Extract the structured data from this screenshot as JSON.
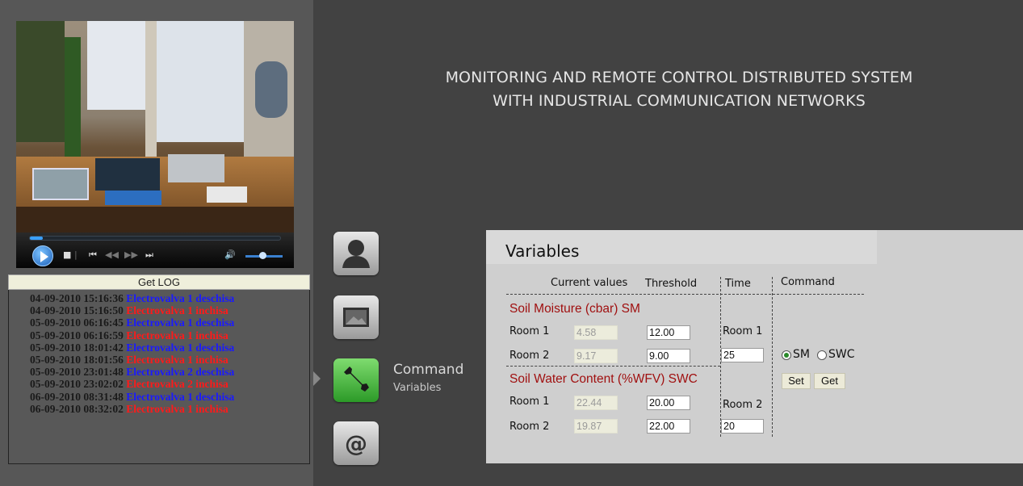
{
  "header": {
    "title_line1": "MONITORING AND REMOTE CONTROL DISTRIBUTED SYSTEM",
    "title_line2": "WITH INDUSTRIAL COMMUNICATION NETWORKS"
  },
  "video": {
    "progress": 0.05,
    "volume": 0.45
  },
  "log": {
    "button_label": "Get LOG",
    "entries": [
      {
        "time": "04-09-2010 15:16:36",
        "message": "Electrovalva 1 deschisa",
        "state": "open"
      },
      {
        "time": "04-09-2010 15:16:50",
        "message": "Electrovalva 1 inchisa",
        "state": "close"
      },
      {
        "time": "05-09-2010 06:16:45",
        "message": "Electrovalva 1 deschisa",
        "state": "open"
      },
      {
        "time": "05-09-2010 06:16:59",
        "message": "Electrovalva 1 inchisa",
        "state": "close"
      },
      {
        "time": "05-09-2010 18:01:42",
        "message": "Electrovalva 1 deschisa",
        "state": "open"
      },
      {
        "time": "05-09-2010 18:01:56",
        "message": "Electrovalva 1 inchisa",
        "state": "close"
      },
      {
        "time": "05-09-2010 23:01:48",
        "message": "Electrovalva 2 deschisa",
        "state": "open"
      },
      {
        "time": "05-09-2010 23:02:02",
        "message": "Electrovalva 2 inchisa",
        "state": "close"
      },
      {
        "time": "06-09-2010 08:31:48",
        "message": "Electrovalva 1 deschisa",
        "state": "open"
      },
      {
        "time": "06-09-2010 08:32:02",
        "message": "Electrovalva 1 inchisa",
        "state": "close"
      }
    ]
  },
  "nav": {
    "items": [
      {
        "icon": "user-icon",
        "active": false
      },
      {
        "icon": "image-icon",
        "active": false
      },
      {
        "icon": "wrench-icon",
        "active": true
      },
      {
        "icon": "at-sign-icon",
        "active": false
      }
    ],
    "active_label": "Command",
    "active_sublabel": "Variables"
  },
  "variables": {
    "title": "Variables",
    "col_current": "Current values",
    "col_threshold": "Threshold",
    "col_time": "Time",
    "col_command": "Command",
    "sm": {
      "title": "Soil Moisture (cbar) SM",
      "room1_label": "Room 1",
      "room1_current": "4.58",
      "room1_threshold": "12.00",
      "room2_label": "Room 2",
      "room2_current": "9.17",
      "room2_threshold": "9.00"
    },
    "swc": {
      "title": "Soil Water Content (%WFV) SWC",
      "room1_label": "Room 1",
      "room1_current": "22.44",
      "room1_threshold": "20.00",
      "room2_label": "Room 2",
      "room2_current": "19.87",
      "room2_threshold": "22.00"
    },
    "time": {
      "room1_label": "Room 1",
      "room1_value": "25",
      "room2_label": "Room 2",
      "room2_value": "20"
    },
    "command": {
      "option_sm": "SM",
      "option_swc": "SWC",
      "selected": "SM",
      "set_label": "Set",
      "get_label": "Get"
    }
  }
}
